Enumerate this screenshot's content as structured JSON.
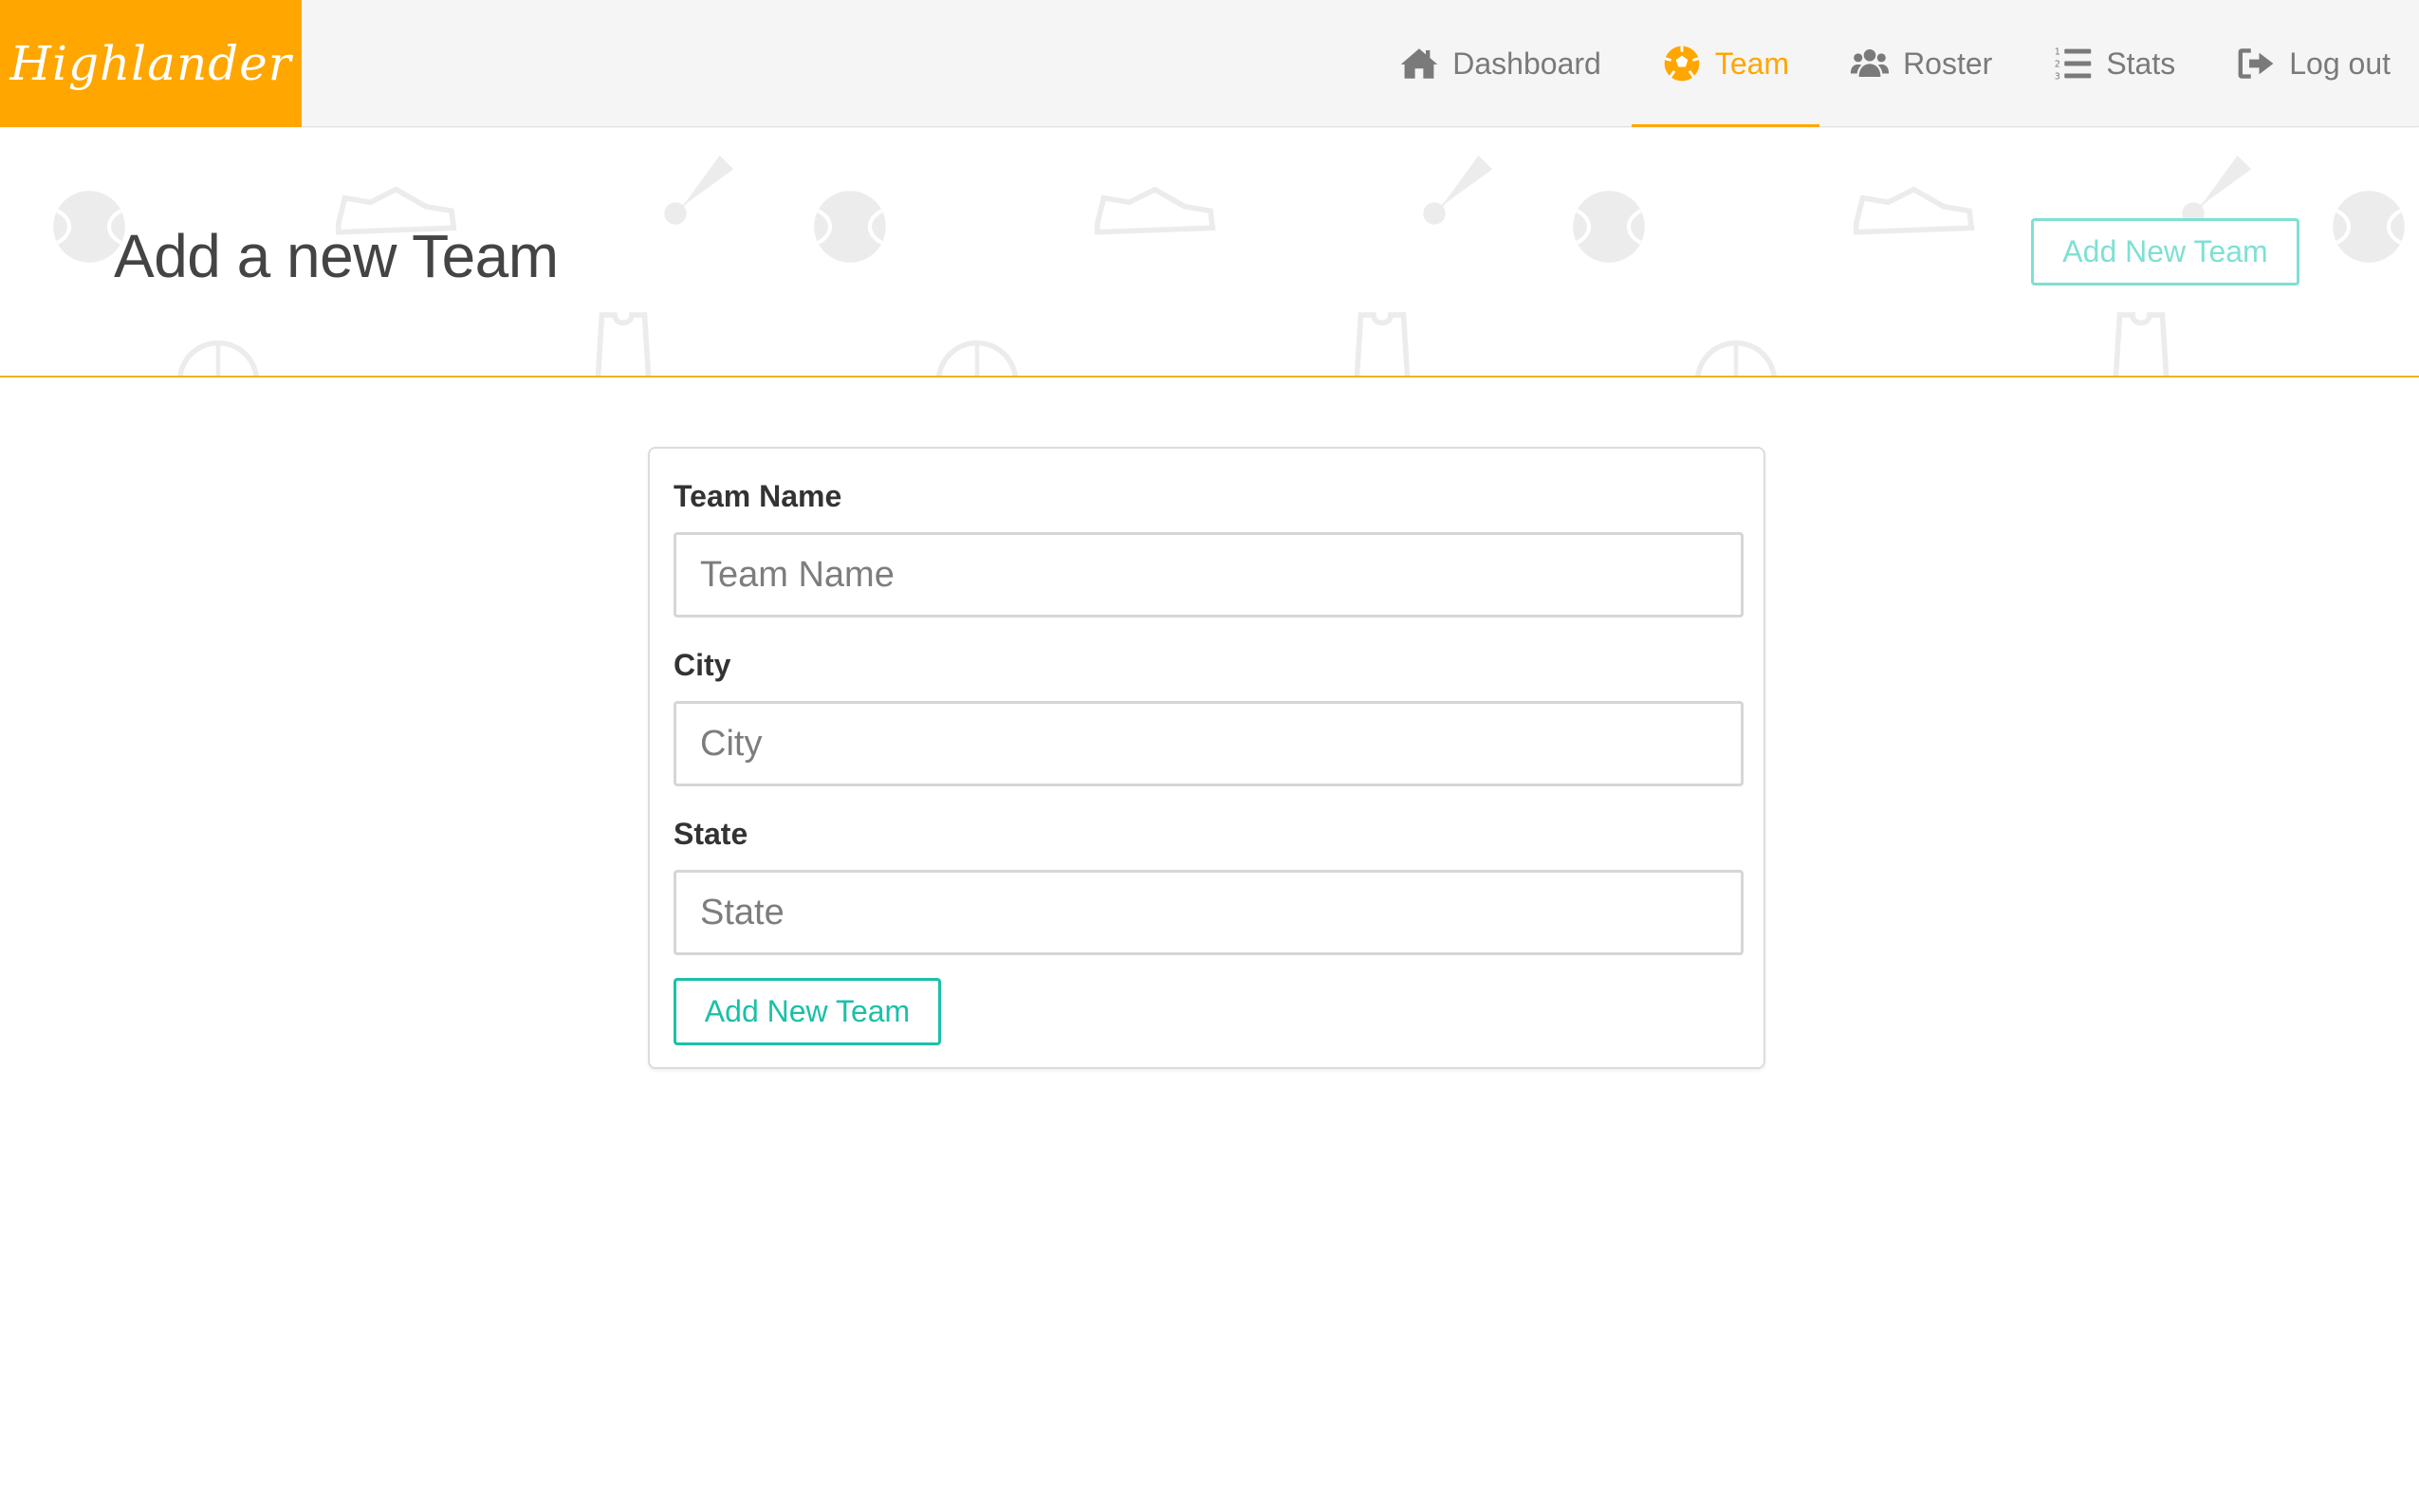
{
  "brand": {
    "name": "Highlander",
    "color": "#ffa600"
  },
  "nav": {
    "items": [
      {
        "label": "Dashboard",
        "icon": "home-icon",
        "active": false
      },
      {
        "label": "Team",
        "icon": "soccer-ball-icon",
        "active": true
      },
      {
        "label": "Roster",
        "icon": "users-icon",
        "active": false
      },
      {
        "label": "Stats",
        "icon": "list-ol-icon",
        "active": false
      },
      {
        "label": "Log out",
        "icon": "sign-out-icon",
        "active": false
      }
    ]
  },
  "header": {
    "title": "Add a new Team",
    "button_label": "Add New Team"
  },
  "form": {
    "fields": [
      {
        "label": "Team Name",
        "placeholder": "Team Name",
        "value": ""
      },
      {
        "label": "City",
        "placeholder": "City",
        "value": ""
      },
      {
        "label": "State",
        "placeholder": "State",
        "value": ""
      }
    ],
    "submit_label": "Add New Team"
  },
  "colors": {
    "accent": "#ffa600",
    "button": "#1ac0a8",
    "header_rule": "#f0b400"
  }
}
